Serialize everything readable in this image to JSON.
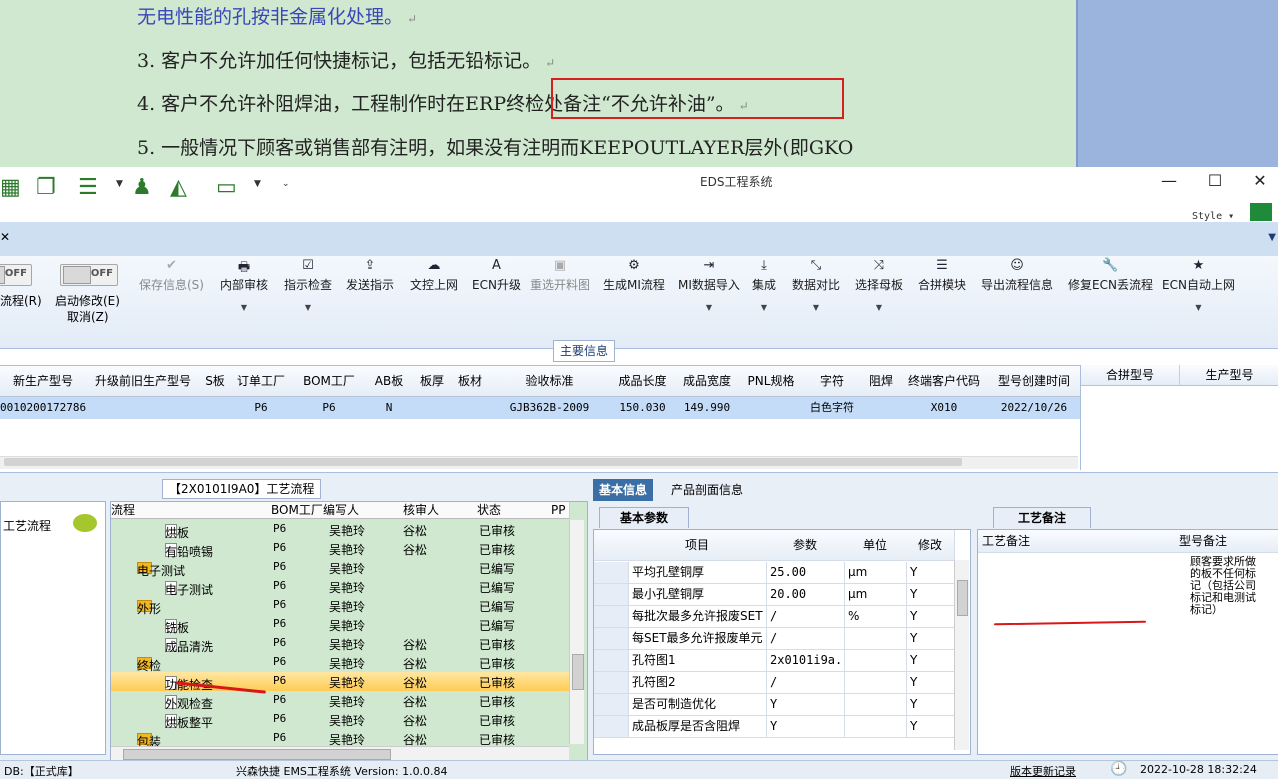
{
  "document": {
    "lines": [
      "无电性能的孔按非金属化处理。",
      "3.  客户不允许加任何快捷标记，包括无铅标记。",
      "4.  客户不允许补阻焊油，工程制作时在ERP终检处备注“不允许补油”。",
      "5.  一般情况下顾客或销售部有注明，如果没有注明而KEEPOUTLAYER层外(即GKO"
    ],
    "para_mark": "↵"
  },
  "titlebar": {
    "app_title": "EDS工程系统",
    "style_label": "Style",
    "min": "—",
    "max": "☐",
    "close": "✕",
    "qa_icons": [
      "grid-icon",
      "copy-icon",
      "list-icon",
      "user-icon",
      "chart-icon",
      "monitor-icon"
    ]
  },
  "tabstrip": {
    "close": "✕",
    "dropdown": "▼"
  },
  "ribbon": {
    "toggle_off": "OFF",
    "flow_label": "流程(R)",
    "auto_modify_label": "启动修改(E)",
    "cancel_label": "取消(Z)",
    "buttons": [
      {
        "label": "保存信息(S)",
        "icon": "✔",
        "disabled": true
      },
      {
        "label": "内部审核",
        "icon": "🖶",
        "dropdown": true
      },
      {
        "label": "指示检查",
        "icon": "☑",
        "dropdown": true
      },
      {
        "label": "发送指示",
        "icon": "⇪"
      },
      {
        "label": "文控上网",
        "icon": "☁"
      },
      {
        "label": "ECN升级",
        "icon": "A"
      },
      {
        "label": "重选开料图",
        "icon": "▣",
        "disabled": true
      },
      {
        "label": "生成MI流程",
        "icon": "⚙"
      },
      {
        "label": "MI数据导入",
        "icon": "⇥",
        "dropdown": true
      },
      {
        "label": "集成",
        "icon": "⤓",
        "dropdown": true
      },
      {
        "label": "数据对比",
        "icon": "⤡",
        "dropdown": true
      },
      {
        "label": "选择母板",
        "icon": "⤨",
        "dropdown": true
      },
      {
        "label": "合拼模块",
        "icon": "☰"
      },
      {
        "label": "导出流程信息",
        "icon": "☺"
      },
      {
        "label": "修复ECN丢流程",
        "icon": "🔧"
      },
      {
        "label": "ECN自动上网",
        "icon": "★",
        "dropdown": true
      }
    ],
    "dropdown_glyph": "▼"
  },
  "main_info": {
    "section_label": "主要信息",
    "columns": [
      "新生产型号",
      "升级前旧生产型号",
      "S板",
      "订单工厂",
      "BOM工厂",
      "AB板",
      "板厚",
      "板材",
      "验收标准",
      "成品长度",
      "成品宽度",
      "PNL规格",
      "字符",
      "阻焊",
      "终端客户代码",
      "型号创建时间"
    ],
    "row": [
      "0010200172786",
      "",
      "",
      "P6",
      "P6",
      "N",
      "",
      "",
      "GJB362B-2009",
      "150.030",
      "149.990",
      "",
      "白色字符",
      "",
      "X010",
      "2022/10/26"
    ],
    "right_columns": [
      "合拼型号",
      "生产型号"
    ]
  },
  "left_panel": {
    "item": "工艺流程",
    "icon": "comment-icon"
  },
  "tree": {
    "title": "【2X0101I9A0】工艺流程",
    "columns": [
      "流程",
      "BOM工厂",
      "编写人",
      "核审人",
      "状态",
      "PP"
    ],
    "rows": [
      {
        "name": "烘板",
        "type": "file",
        "level": 2,
        "bom": "P6",
        "writer": "吴艳玲",
        "reviewer": "谷松",
        "status": "已审核"
      },
      {
        "name": "有铅喷锡",
        "type": "file",
        "level": 2,
        "bom": "P6",
        "writer": "吴艳玲",
        "reviewer": "谷松",
        "status": "已审核"
      },
      {
        "name": "电子测试",
        "type": "folder",
        "level": 1,
        "bom": "P6",
        "writer": "吴艳玲",
        "reviewer": "",
        "status": "已编写"
      },
      {
        "name": "电子测试",
        "type": "file",
        "level": 2,
        "bom": "P6",
        "writer": "吴艳玲",
        "reviewer": "",
        "status": "已编写"
      },
      {
        "name": "外形",
        "type": "folder",
        "level": 1,
        "bom": "P6",
        "writer": "吴艳玲",
        "reviewer": "",
        "status": "已编写"
      },
      {
        "name": "铣板",
        "type": "file",
        "level": 2,
        "bom": "P6",
        "writer": "吴艳玲",
        "reviewer": "",
        "status": "已编写"
      },
      {
        "name": "成品清洗",
        "type": "file",
        "level": 2,
        "bom": "P6",
        "writer": "吴艳玲",
        "reviewer": "谷松",
        "status": "已审核"
      },
      {
        "name": "终检",
        "type": "folder",
        "level": 1,
        "bom": "P6",
        "writer": "吴艳玲",
        "reviewer": "谷松",
        "status": "已审核"
      },
      {
        "name": "功能检查",
        "type": "file",
        "level": 2,
        "bom": "P6",
        "writer": "吴艳玲",
        "reviewer": "谷松",
        "status": "已审核",
        "selected": true
      },
      {
        "name": "外观检查",
        "type": "file",
        "level": 2,
        "bom": "P6",
        "writer": "吴艳玲",
        "reviewer": "谷松",
        "status": "已审核"
      },
      {
        "name": "烘板整平",
        "type": "file",
        "level": 2,
        "bom": "P6",
        "writer": "吴艳玲",
        "reviewer": "谷松",
        "status": "已审核"
      },
      {
        "name": "包装",
        "type": "folder",
        "level": 1,
        "bom": "P6",
        "writer": "吴艳玲",
        "reviewer": "谷松",
        "status": "已审核"
      }
    ]
  },
  "info_panel": {
    "tabs": [
      "基本信息",
      "产品剖面信息"
    ],
    "param_tab": "基本参数",
    "param_columns": [
      "项目",
      "参数",
      "单位",
      "修改"
    ],
    "params": [
      [
        "平均孔壁铜厚",
        "25.00",
        "μm",
        "Y"
      ],
      [
        "最小孔壁铜厚",
        "20.00",
        "μm",
        "Y"
      ],
      [
        "每批次最多允许报废SET",
        "/",
        "%",
        "Y"
      ],
      [
        "每SET最多允许报废单元",
        "/",
        "",
        "Y"
      ],
      [
        "孔符图1",
        "2x0101i9a...",
        "",
        "Y"
      ],
      [
        "孔符图2",
        "/",
        "",
        "Y"
      ],
      [
        "是否可制造优化",
        "Y",
        "",
        "Y"
      ],
      [
        "成品板厚是否含阻焊",
        "Y",
        "",
        "Y"
      ]
    ],
    "proc_tab": "工艺备注",
    "proc_columns": [
      "工艺备注",
      "型号备注"
    ],
    "model_note": "顾客要求所做的板不任何标记（包括公司标记和电测试标记）"
  },
  "status": {
    "db": "DB:【正式库】",
    "app": "兴森快捷 EMS工程系统 Version: 1.0.0.84",
    "update_link": "版本更新记录",
    "datetime": "2022-10-28 18:32:24"
  },
  "colors": {
    "accent": "#3a6ea5",
    "highlight_box": "#d81e1e",
    "tree_bg": "#cfe8cf",
    "selected_row": "#ffcc55"
  }
}
